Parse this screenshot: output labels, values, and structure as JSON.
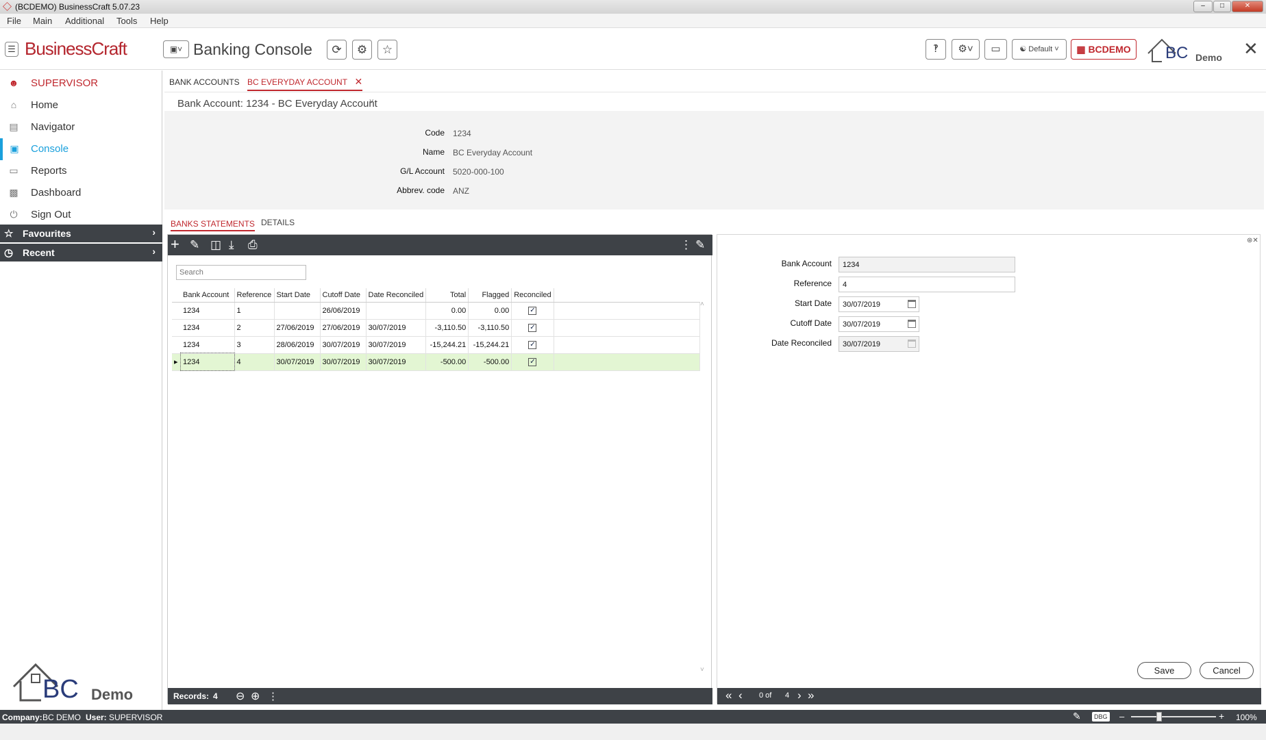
{
  "window": {
    "title": "(BCDEMO) BusinessCraft  5.07.23"
  },
  "menu": [
    "File",
    "Main",
    "Additional",
    "Tools",
    "Help"
  ],
  "app": {
    "brand": "BusinessCraft",
    "console_title": "Banking Console",
    "profile": "Default",
    "company_badge": "BCDEMO",
    "demo_label": "Demo",
    "logo_letters": "BC"
  },
  "sidebar": {
    "user": "SUPERVISOR",
    "items": [
      {
        "label": "Home",
        "icon": "home-icon"
      },
      {
        "label": "Navigator",
        "icon": "map-icon"
      },
      {
        "label": "Console",
        "icon": "console-icon",
        "active": true
      },
      {
        "label": "Reports",
        "icon": "document-icon"
      },
      {
        "label": "Dashboard",
        "icon": "chart-icon"
      },
      {
        "label": "Sign Out",
        "icon": "power-icon"
      }
    ],
    "favourites": "Favourites",
    "recent": "Recent",
    "footer_demo": "Demo",
    "footer_letters": "BC"
  },
  "tabs": {
    "bank_accounts": "BANK ACCOUNTS",
    "current": "BC EVERYDAY ACCOUNT"
  },
  "record_header": "Bank Account: 1234 - BC Everyday Account",
  "account": {
    "labels": {
      "code": "Code",
      "name": "Name",
      "gl": "G/L Account",
      "abbrev": "Abbrev. code"
    },
    "values": {
      "code": "1234",
      "name": "BC Everyday Account",
      "gl": "5020-000-100",
      "abbrev": "ANZ"
    }
  },
  "subtabs": {
    "statements": "BANKS STATEMENTS",
    "details": "DETAILS"
  },
  "grid": {
    "search_placeholder": "Search",
    "columns": [
      "Bank Account",
      "Reference",
      "Start Date",
      "Cutoff Date",
      "Date Reconciled",
      "Total",
      "Flagged",
      "Reconciled"
    ],
    "rows": [
      [
        "1234",
        "1",
        "",
        "26/06/2019",
        "",
        "0.00",
        "0.00",
        true
      ],
      [
        "1234",
        "2",
        "27/06/2019",
        "27/06/2019",
        "30/07/2019",
        "-3,110.50",
        "-3,110.50",
        true
      ],
      [
        "1234",
        "3",
        "28/06/2019",
        "30/07/2019",
        "30/07/2019",
        "-15,244.21",
        "-15,244.21",
        true
      ],
      [
        "1234",
        "4",
        "30/07/2019",
        "30/07/2019",
        "30/07/2019",
        "-500.00",
        "-500.00",
        true
      ]
    ],
    "selected_row": 3,
    "records_label": "Records:",
    "records_count": "4"
  },
  "detail": {
    "labels": {
      "bank_account": "Bank Account",
      "reference": "Reference",
      "start_date": "Start Date",
      "cutoff_date": "Cutoff Date",
      "date_reconciled": "Date Reconciled"
    },
    "values": {
      "bank_account": "1234",
      "reference": "4",
      "start_date": "30/07/2019",
      "cutoff_date": "30/07/2019",
      "date_reconciled": "30/07/2019"
    },
    "save": "Save",
    "cancel": "Cancel",
    "pager_current": "0 of",
    "pager_total": "4"
  },
  "status": {
    "company_label": "Company:",
    "company": "BC DEMO",
    "user_label": "User:",
    "user": "SUPERVISOR",
    "dbg": "DBG",
    "zoom": "100%"
  }
}
